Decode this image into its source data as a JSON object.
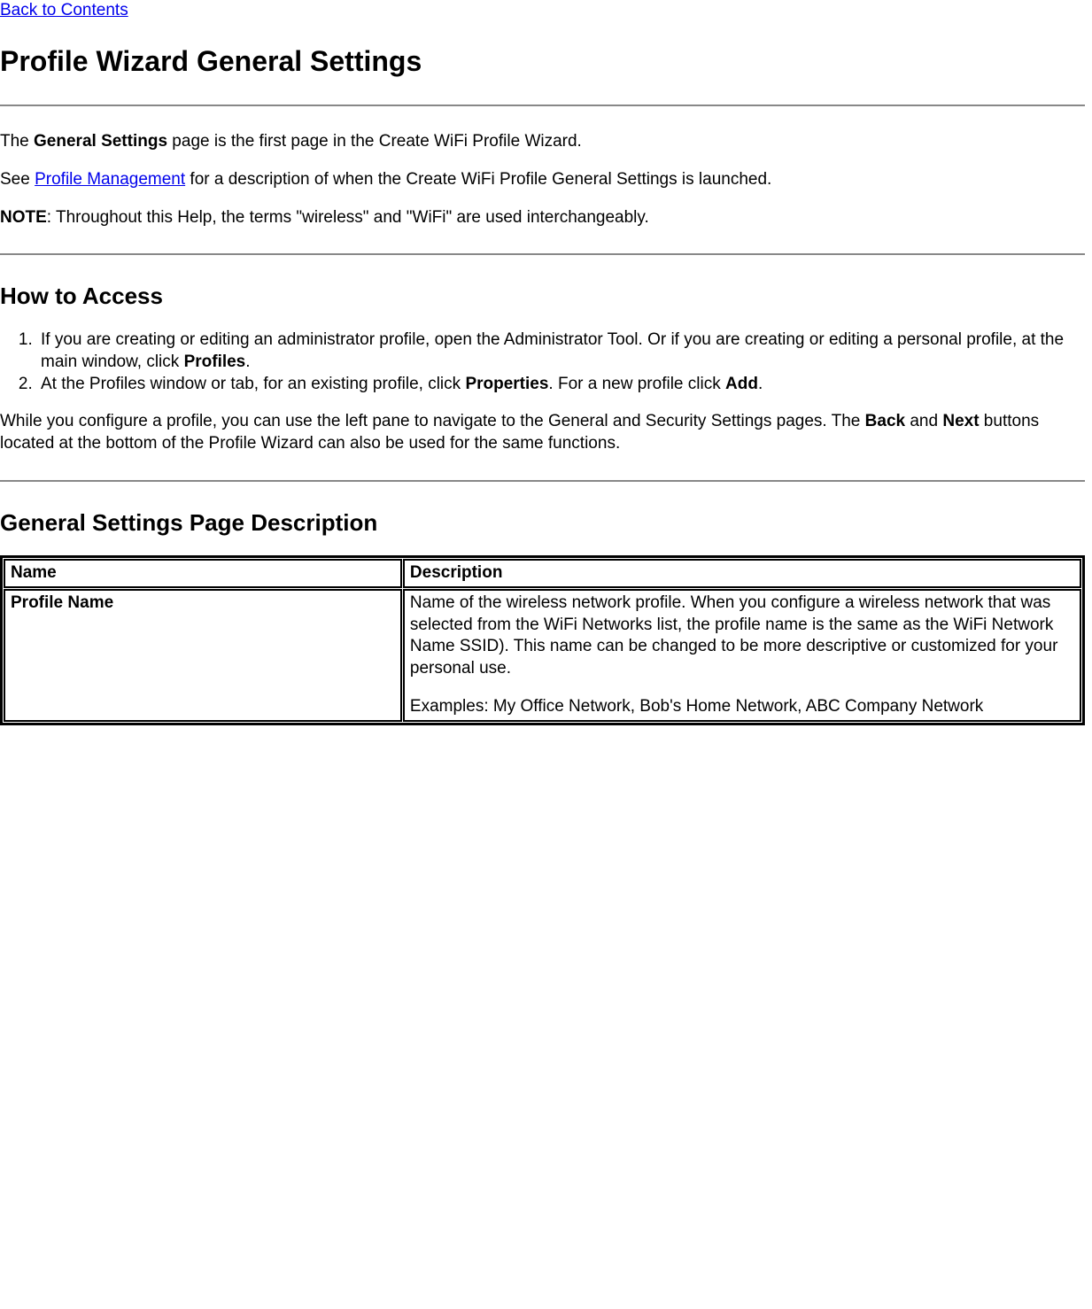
{
  "nav": {
    "back_link": "Back to Contents"
  },
  "headings": {
    "h1": "Profile Wizard General Settings",
    "h2a": "How to Access",
    "h2b": "General Settings Page Description"
  },
  "intro": {
    "p1_pre": "The ",
    "p1_bold": "General Settings",
    "p1_post": " page is the first page in the Create WiFi Profile Wizard.",
    "p2_pre": "See ",
    "p2_link": "Profile Management",
    "p2_post": " for a description of when the Create WiFi Profile General Settings is launched.",
    "note_label": "NOTE",
    "note_text": ": Throughout this Help, the terms \"wireless\" and \"WiFi\" are used interchangeably."
  },
  "steps": {
    "s1_pre": "If you are creating or editing an administrator profile, open the Administrator Tool. Or if you are creating or editing a personal profile, at the main window, click ",
    "s1_b": "Profiles",
    "s1_post": ".",
    "s2_pre": "At the Profiles window or tab, for an existing profile, click ",
    "s2_b1": "Properties",
    "s2_mid": ". For a new profile click ",
    "s2_b2": "Add",
    "s2_post": "."
  },
  "nav_para": {
    "pre": "While you configure a profile, you can use the left pane to navigate to the General and Security Settings pages. The ",
    "b1": "Back",
    "mid": " and ",
    "b2": "Next",
    "post": " buttons located at the bottom of the Profile Wizard can also be used for the same functions."
  },
  "table": {
    "hdr_name": "Name",
    "hdr_desc": "Description",
    "row1_name": "Profile Name",
    "row1_desc_p1": "Name of the wireless network profile. When you configure a wireless network that was selected from the WiFi Networks list, the profile name is the same as the WiFi Network Name SSID). This name can be changed to be more descriptive or customized for your personal use.",
    "row1_desc_p2": "Examples: My Office Network, Bob's Home Network, ABC Company Network"
  }
}
